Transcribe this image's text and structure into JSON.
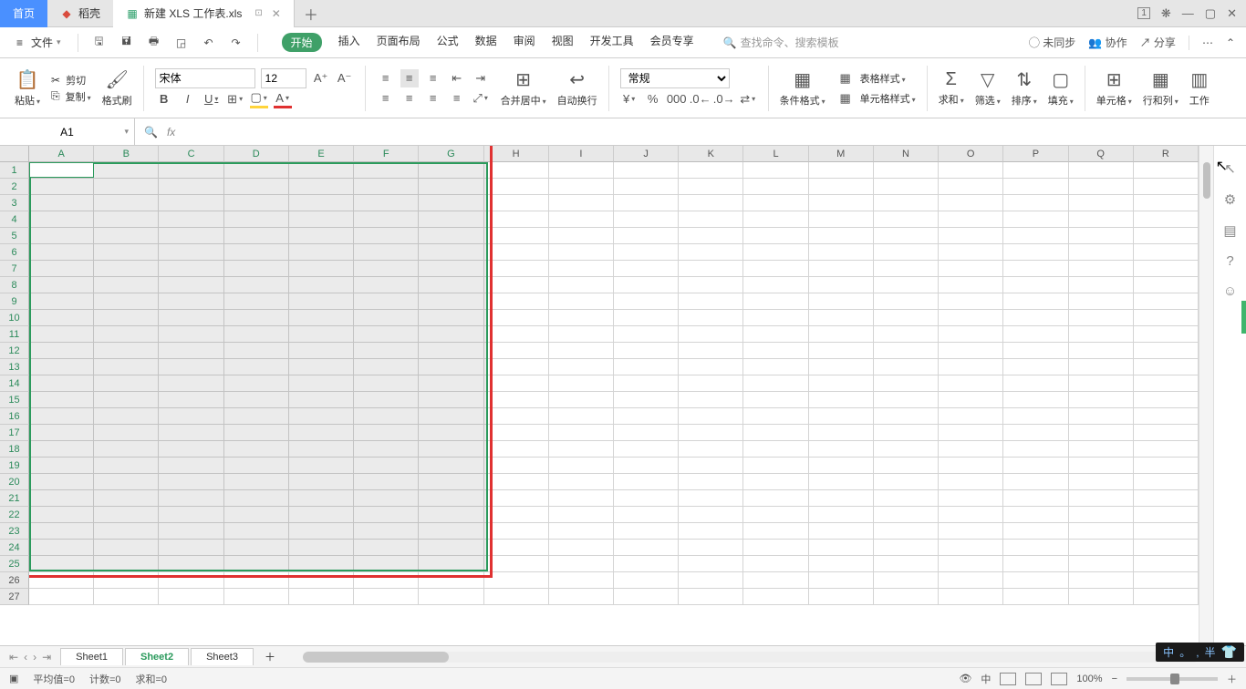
{
  "titlebar": {
    "home": "首页",
    "docker": "稻壳",
    "doc": "新建 XLS 工作表.xls",
    "badge": "1"
  },
  "menubar": {
    "file": "文件",
    "tabs": {
      "start": "开始",
      "insert": "插入",
      "layout": "页面布局",
      "formula": "公式",
      "data": "数据",
      "review": "审阅",
      "view": "视图",
      "dev": "开发工具",
      "member": "会员专享"
    },
    "search_placeholder": "查找命令、搜索模板",
    "unsync": "未同步",
    "collab": "协作",
    "share": "分享"
  },
  "ribbon": {
    "paste": "粘贴",
    "cut": "剪切",
    "copy": "复制",
    "format_painter": "格式刷",
    "font_name": "宋体",
    "font_size": "12",
    "merge": "合并居中",
    "wrap": "自动换行",
    "number_format": "常规",
    "cond_format": "条件格式",
    "table_style": "表格样式",
    "cell_style": "单元格样式",
    "sum": "求和",
    "filter": "筛选",
    "sort": "排序",
    "fill": "填充",
    "cell": "单元格",
    "rowcol": "行和列",
    "worksheet": "工作"
  },
  "formula_bar": {
    "name_box": "A1"
  },
  "columns": [
    "A",
    "B",
    "C",
    "D",
    "E",
    "F",
    "G",
    "H",
    "I",
    "J",
    "K",
    "L",
    "M",
    "N",
    "O",
    "P",
    "Q",
    "R"
  ],
  "rows_count": 27,
  "selected_cols": 7,
  "selected_rows": 25,
  "sheets": {
    "s1": "Sheet1",
    "s2": "Sheet2",
    "s3": "Sheet3"
  },
  "statusbar": {
    "avg": "平均值=0",
    "count": "计数=0",
    "sum": "求和=0",
    "zoom": "100%"
  },
  "ime": {
    "left": "中",
    "dot": "。",
    "right": "半",
    "comma": ","
  }
}
